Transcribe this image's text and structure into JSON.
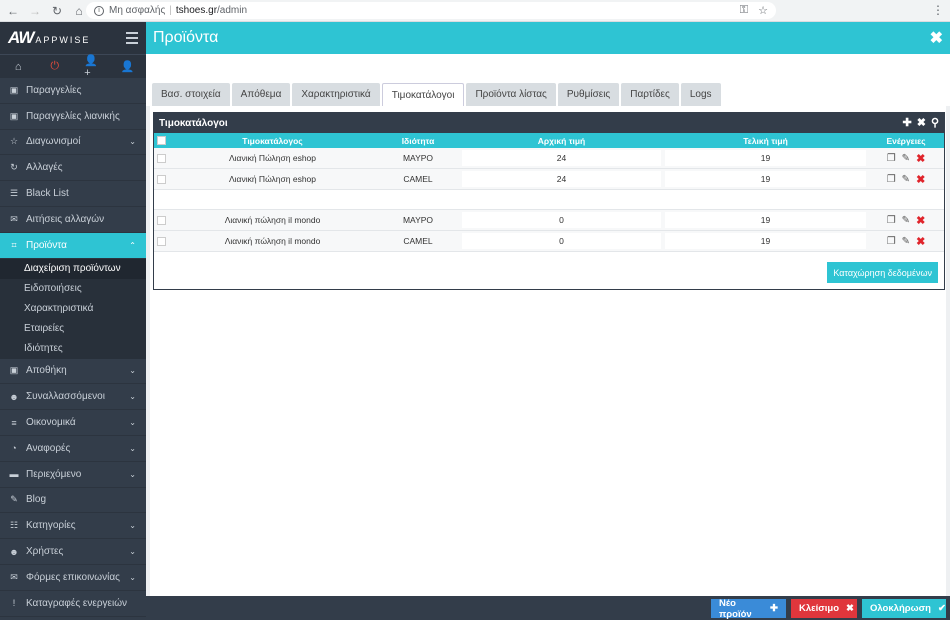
{
  "browser": {
    "security_label": "Μη ασφαλής",
    "host": "tshoes.gr",
    "path": "/admin"
  },
  "sidebar": {
    "logo_main": "AW",
    "logo_sub": "APPWISE",
    "items": [
      {
        "label": "Παραγγελίες",
        "icon": "box-icon",
        "chevron": false
      },
      {
        "label": "Παραγγελίες λιανικής",
        "icon": "box-icon",
        "chevron": false
      },
      {
        "label": "Διαγωνισμοί",
        "icon": "trophy-icon",
        "chevron": true
      },
      {
        "label": "Αλλαγές",
        "icon": "refresh-icon",
        "chevron": false
      },
      {
        "label": "Black List",
        "icon": "list-icon",
        "chevron": false
      },
      {
        "label": "Αιτήσεις αλλαγών",
        "icon": "envelope-icon",
        "chevron": false
      },
      {
        "label": "Προϊόντα",
        "icon": "cart-icon",
        "chevron": true,
        "active": true
      }
    ],
    "subitems": [
      {
        "label": "Διαχείριση προϊόντων",
        "current": true
      },
      {
        "label": "Ειδοποιήσεις"
      },
      {
        "label": "Χαρακτηριστικά"
      },
      {
        "label": "Εταιρείες"
      },
      {
        "label": "Ιδιότητες"
      }
    ],
    "items_after": [
      {
        "label": "Αποθήκη",
        "icon": "box-icon",
        "chevron": true
      },
      {
        "label": "Συναλλασσόμενοι",
        "icon": "users-icon",
        "chevron": true
      },
      {
        "label": "Οικονομικά",
        "icon": "chart-icon",
        "chevron": true
      },
      {
        "label": "Αναφορές",
        "icon": "pie-icon",
        "chevron": true
      },
      {
        "label": "Περιεχόμενο",
        "icon": "folder-icon",
        "chevron": true
      },
      {
        "label": "Blog",
        "icon": "pencil-icon",
        "chevron": false
      },
      {
        "label": "Κατηγορίες",
        "icon": "sitemap-icon",
        "chevron": true
      },
      {
        "label": "Χρήστες",
        "icon": "users-icon",
        "chevron": true
      },
      {
        "label": "Φόρμες επικοινωνίας",
        "icon": "envelope-icon",
        "chevron": true
      },
      {
        "label": "Καταγραφές ενεργειών",
        "icon": "exclamation-icon",
        "chevron": false
      }
    ]
  },
  "header": {
    "title": "Προϊόντα"
  },
  "tabs": [
    {
      "label": "Βασ. στοιχεία"
    },
    {
      "label": "Απόθεμα"
    },
    {
      "label": "Χαρακτηριστικά"
    },
    {
      "label": "Τιμοκατάλογοι",
      "active": true
    },
    {
      "label": "Προϊόντα λίστας"
    },
    {
      "label": "Ρυθμίσεις"
    },
    {
      "label": "Παρτίδες"
    },
    {
      "label": "Logs"
    }
  ],
  "pricelist": {
    "title": "Τιμοκατάλογοι",
    "columns": [
      "Τιμοκατάλογος",
      "Ιδιότητα",
      "Αρχική τιμή",
      "Τελική τιμή",
      "Ενέργειες"
    ],
    "rows": [
      {
        "pricelist": "Λιανική Πώληση eshop",
        "attribute": "ΜΑΥΡΟ",
        "initial": "24",
        "final": "19"
      },
      {
        "pricelist": "Λιανική Πώληση eshop",
        "attribute": "CAMEL",
        "initial": "24",
        "final": "19"
      },
      {
        "pricelist": "Λιανική πώληση il mondo",
        "attribute": "ΜΑΥΡΟ",
        "initial": "0",
        "final": "19"
      },
      {
        "pricelist": "Λιανική πώληση il mondo",
        "attribute": "CAMEL",
        "initial": "0",
        "final": "19"
      }
    ],
    "save_label": "Καταχώρηση δεδομένων"
  },
  "footer": {
    "new_label": "Νέο προϊόν",
    "close_label": "Κλείσιμο",
    "done_label": "Ολοκλήρωση"
  }
}
